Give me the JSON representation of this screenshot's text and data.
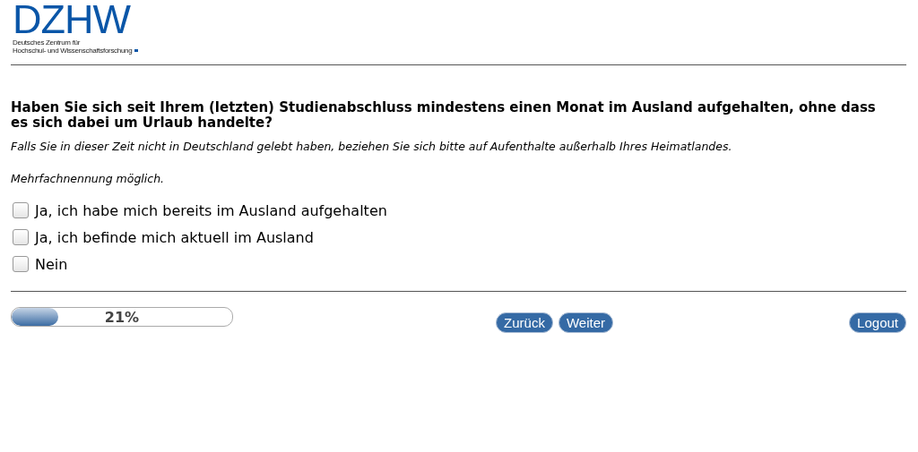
{
  "logo": {
    "wordmark": "DZHW",
    "subtitle_lines": [
      "Deutsches Zentrum für",
      "Hochschul- und Wissenschaftsforschung"
    ]
  },
  "question": {
    "title": "Haben Sie sich seit Ihrem (letzten) Studienabschluss mindestens einen Monat im Ausland aufgehalten, ohne dass es sich dabei um Urlaub handelte?",
    "hint": "Falls Sie in dieser Zeit nicht in Deutschland gelebt haben, beziehen Sie sich bitte auf Aufenthalte außerhalb Ihres Heimatlandes.",
    "instruction": "Mehrfachnennung möglich."
  },
  "options": [
    {
      "label": "Ja, ich habe mich bereits im Ausland aufgehalten",
      "checked": false
    },
    {
      "label": "Ja, ich befinde mich aktuell im Ausland",
      "checked": false
    },
    {
      "label": "Nein",
      "checked": false
    }
  ],
  "progress": {
    "level": 0.21,
    "reading": "21%"
  },
  "nav_buttons": [
    "Zurück",
    "Weiter"
  ],
  "logout": "Logout"
}
